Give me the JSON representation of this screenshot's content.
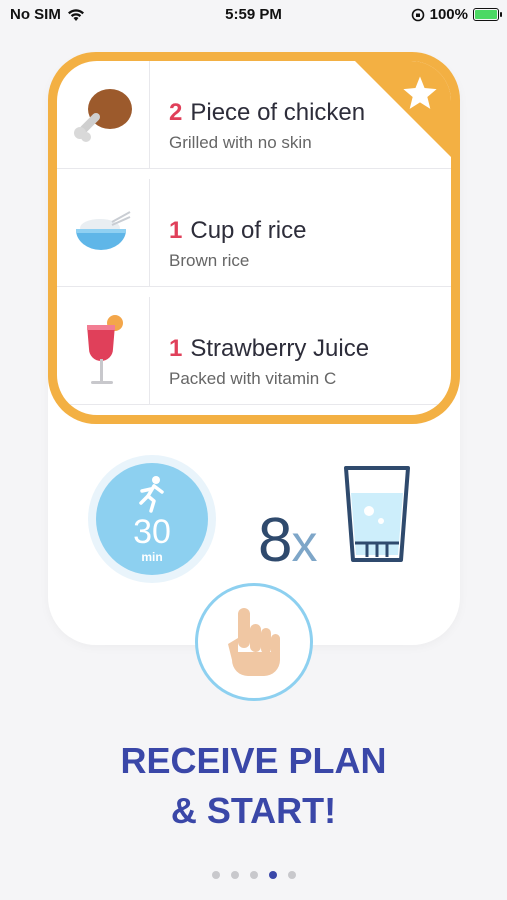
{
  "status_bar": {
    "carrier": "No SIM",
    "time": "5:59 PM",
    "battery_percent": "100%",
    "battery_level": 1.0
  },
  "meal_plan": {
    "items": [
      {
        "quantity": "2",
        "title": "Piece of chicken",
        "subtitle": "Grilled with no skin",
        "icon": "chicken-leg-icon"
      },
      {
        "quantity": "1",
        "title": "Cup of rice",
        "subtitle": "Brown rice",
        "icon": "rice-bowl-icon"
      },
      {
        "quantity": "1",
        "title": "Strawberry Juice",
        "subtitle": "Packed with vitamin C",
        "icon": "juice-glass-icon"
      }
    ]
  },
  "activity": {
    "value": "30",
    "unit": "min",
    "icon": "running-icon"
  },
  "water": {
    "count": "8",
    "multiplier": "x",
    "icon": "water-glass-icon"
  },
  "headline": {
    "line1": "RECEIVE PLAN",
    "line2": "& START!"
  },
  "pagination": {
    "total": 5,
    "current": 4
  },
  "colors": {
    "accent_orange": "#f3b043",
    "quantity_red": "#e0405a",
    "headline_blue": "#3a47a8",
    "activity_blue": "#8dd0f0"
  }
}
